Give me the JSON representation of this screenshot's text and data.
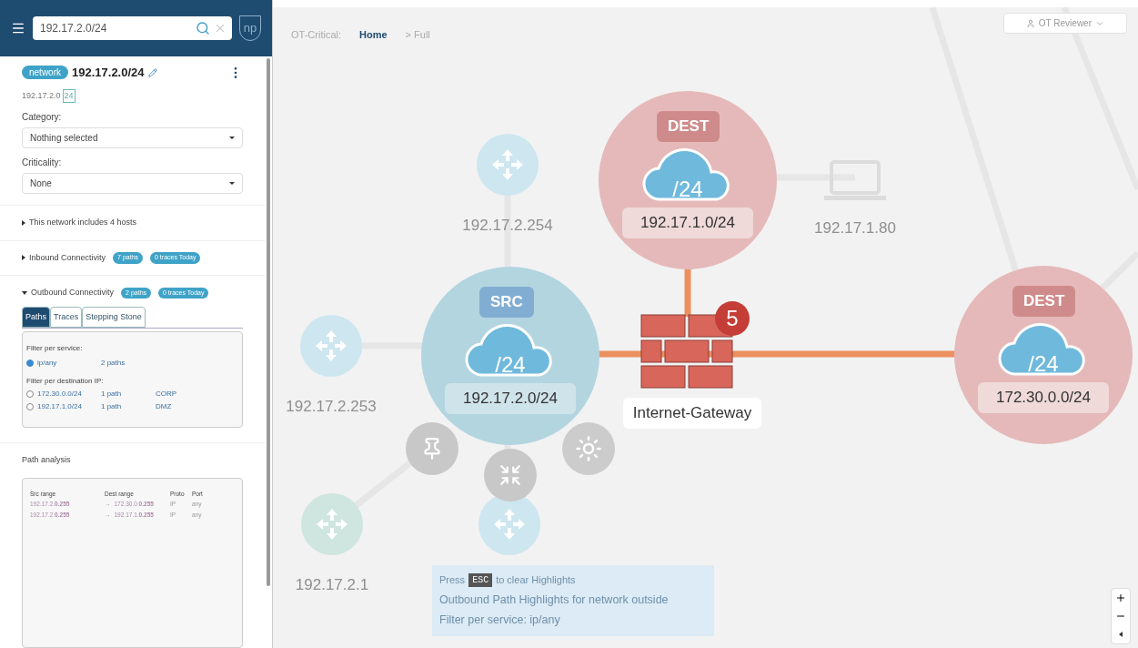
{
  "search": {
    "value": "192.17.2.0/24"
  },
  "logo": {
    "text": "np"
  },
  "entity": {
    "tag": "network",
    "name": "192.17.2.0/24",
    "address": "192.17.2.0",
    "prefix": "24"
  },
  "fields": [
    {
      "label": "Category:",
      "value": "Nothing selected"
    },
    {
      "label": "Criticality:",
      "value": "None"
    }
  ],
  "sections": [
    {
      "title": "This network includes 4 hosts",
      "expanded": false
    },
    {
      "title": "Inbound Connectivity",
      "expanded": false,
      "badges": [
        "7 paths",
        "0 traces Today"
      ]
    },
    {
      "title": "Outbound Connectivity",
      "expanded": true,
      "badges": [
        "2 paths",
        "0 traces Today"
      ]
    }
  ],
  "tabs": [
    {
      "label": "Paths",
      "selected": true
    },
    {
      "label": "Traces",
      "selected": false
    },
    {
      "label": "Stepping Stone",
      "selected": false
    }
  ],
  "filter": {
    "service_label": "Filter per service:",
    "services": [
      {
        "name": "ip/any",
        "count": "2 paths",
        "selected": true
      }
    ],
    "destination_label": "Filter per destination IP:",
    "destinations": [
      {
        "name": "172.30.0.0/24",
        "count": "1 path",
        "zone": "CORP",
        "selected": false
      },
      {
        "name": "192.17.1.0/24",
        "count": "1 path",
        "zone": "DMZ",
        "selected": false
      }
    ]
  },
  "path_analysis": {
    "title": "Path analysis",
    "columns": [
      "Src range",
      "Dest range",
      "Proto",
      "Port"
    ],
    "rows": [
      {
        "src": "192.17.2.**0.255**",
        "arrow": "→",
        "dest": "172.30.0.**0.255**",
        "proto": "IP",
        "port": "any"
      },
      {
        "src": "192.17.2.**0.255**",
        "arrow": "→",
        "dest": "192.17.1.**0.255**",
        "proto": "IP",
        "port": "any"
      }
    ]
  },
  "breadcrumb": {
    "label": "OT-Critical:",
    "items": [
      {
        "text": "Home",
        "selected": true
      },
      {
        "text": "> Full",
        "selected": false
      }
    ]
  },
  "user_menu": {
    "name": "OT Reviewer"
  },
  "nodes": [
    {
      "kind": "router",
      "label": "192.17.2.254"
    },
    {
      "kind": "subnet",
      "role": "DEST",
      "prefix": "/24",
      "label": "192.17.1.0/24",
      "color": "#e5b9b9"
    },
    {
      "kind": "laptop",
      "label": "192.17.1.80"
    },
    {
      "kind": "router",
      "label": "192.17.2.253"
    },
    {
      "kind": "subnet",
      "role": "SRC",
      "prefix": "/24",
      "label": "192.17.2.0/24",
      "color": "#b3d5e0"
    },
    {
      "kind": "firewall",
      "label": "Internet-Gateway",
      "count": "5"
    },
    {
      "kind": "subnet",
      "role": "DEST",
      "prefix": "/24",
      "label": "172.30.0.0/24",
      "color": "#e5b9b9"
    },
    {
      "kind": "router",
      "label": "192.17.2.1"
    },
    {
      "kind": "router"
    }
  ],
  "hint": {
    "press": "Press",
    "key": "ESC",
    "rest": "to clear Highlights",
    "lines": [
      "Outbound Path Highlights for network outside",
      "Filter per service: ip/any"
    ]
  }
}
